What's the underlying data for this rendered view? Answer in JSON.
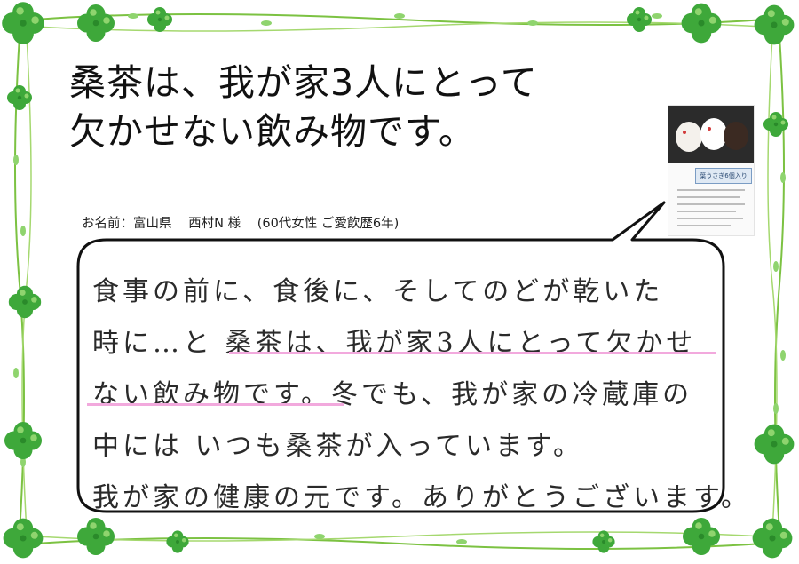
{
  "title": {
    "line1": "桑茶は、我が家3人にとって",
    "line2": "欠かせない飲み物です。"
  },
  "author": {
    "label": "お名前：富山県",
    "name": "西村N 様",
    "detail": "(60代女性 ご愛飲歴6年)"
  },
  "handwriting": {
    "line1": "食事の前に、食後に、そしてのどが乾いた",
    "line2": "時に…と 桑茶は、我が家3人にとって欠かせ",
    "line3": "ない飲み物です。冬でも、我が家の冷蔵庫の",
    "line4": "中には いつも桑茶が入っています。",
    "line5": " 我が家の健康の元です。ありがとうございます。"
  },
  "product_card": {
    "label": "葉うさぎ6個入り"
  },
  "colors": {
    "frame_green": "#7cc242",
    "clover_green": "#3ea83a",
    "clover_light": "#8fd46e",
    "highlight_pink": "#f2a9dd",
    "bubble_stroke": "#111111"
  },
  "icons": [
    "clover-icon"
  ]
}
